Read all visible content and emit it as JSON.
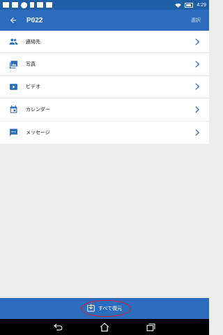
{
  "status_bar": {
    "time": "4:29",
    "icons": [
      "mail-icon",
      "image-icon",
      "vpn-icon",
      "alert-icon",
      "photo-icon",
      "envelope-icon"
    ]
  },
  "header": {
    "title": "P022",
    "action_label": "選択",
    "back_icon": "arrow-back-icon"
  },
  "list": {
    "items": [
      {
        "label": "連絡先",
        "icon": "contacts-icon"
      },
      {
        "label": "写真",
        "icon": "photo-icon"
      },
      {
        "label": "ビデオ",
        "icon": "video-icon"
      },
      {
        "label": "カレンダー",
        "icon": "calendar-icon"
      },
      {
        "label": "メッセージ",
        "icon": "message-icon"
      }
    ]
  },
  "footer": {
    "restore_all_label": "すべて復元",
    "restore_icon": "download-icon"
  },
  "colors": {
    "primary": "#2c6cbc",
    "status_bar": "#1f5fa8",
    "icon": "#2c6cbc",
    "highlight": "#d81b3a"
  }
}
